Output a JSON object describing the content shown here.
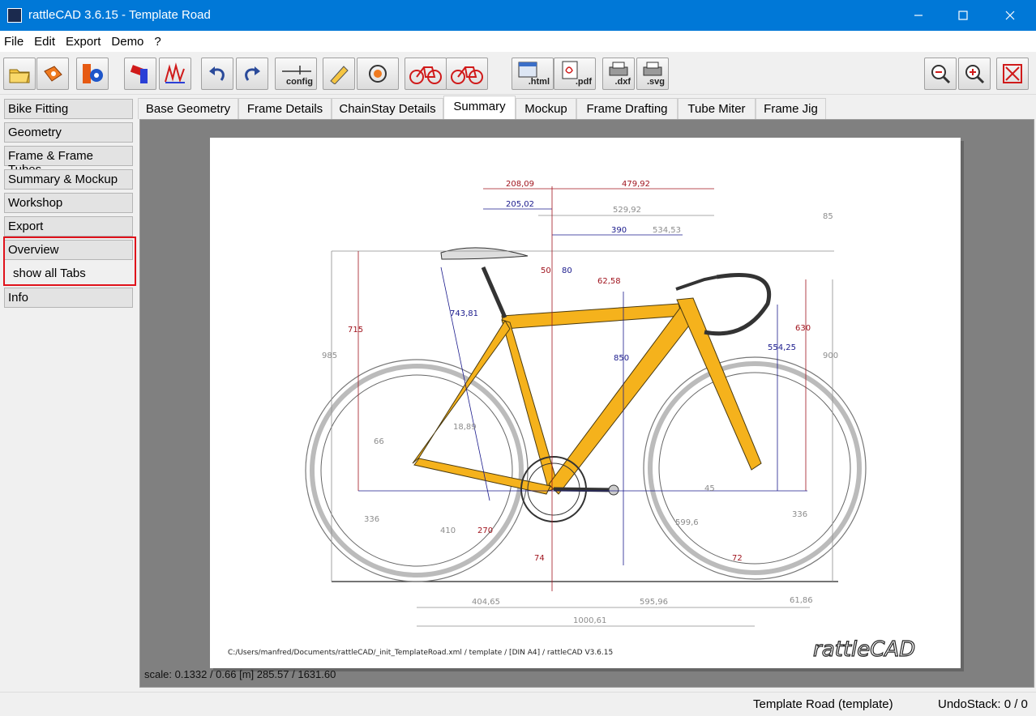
{
  "window": {
    "title": "rattleCAD  3.6.15 - Template Road"
  },
  "menu": [
    "File",
    "Edit",
    "Export",
    "Demo",
    "?"
  ],
  "toolbar": {
    "config_label": "config",
    "html_label": ".html",
    "pdf_label": ".pdf",
    "dxf_label": ".dxf",
    "svg_label": ".svg"
  },
  "sidebar": {
    "items": [
      "Bike Fitting",
      "Geometry",
      "Frame & Frame Tubes",
      "Summary & Mockup",
      "Workshop",
      "Export",
      "Overview",
      "Info"
    ],
    "sub_item": "show all Tabs"
  },
  "tabs": [
    "Base Geometry",
    "Frame Details",
    "ChainStay Details",
    "Summary",
    "Mockup",
    "Frame Drafting",
    "Tube Miter",
    "Frame Jig"
  ],
  "active_tab": "Summary",
  "drawing": {
    "dims_top": [
      "208,09",
      "479,92",
      "205,02",
      "529,92",
      "534,53",
      "390",
      "85",
      "50",
      "80",
      "62,58"
    ],
    "dims_vertical": [
      "985",
      "715",
      "743,81",
      "850",
      "554,25",
      "630",
      "900",
      "66",
      "270"
    ],
    "dims_misc": [
      "18,89",
      "336",
      "410",
      "599,6",
      "45",
      "336",
      "74",
      "72"
    ],
    "dims_bottom": [
      "404,65",
      "595,96",
      "61,86",
      "1000,61"
    ],
    "footer": "C:/Users/manfred/Documents/rattleCAD/_init_TemplateRoad.xml   /   template   /  [DIN A4]   /   rattleCAD   V3.6.15",
    "logo": "rattleCAD"
  },
  "scale_text": "scale: 0.1332 / 0.66  [m]  285.57 / 1631.60",
  "status": {
    "document": "Template Road (template)",
    "undo": "UndoStack:  0 /  0"
  },
  "colors": {
    "frame": "#f5b21c",
    "dim_red": "#a0141e",
    "dim_blue": "#1a1a8c",
    "dim_gray": "#8c8c8c",
    "accent": "#0078d7"
  }
}
